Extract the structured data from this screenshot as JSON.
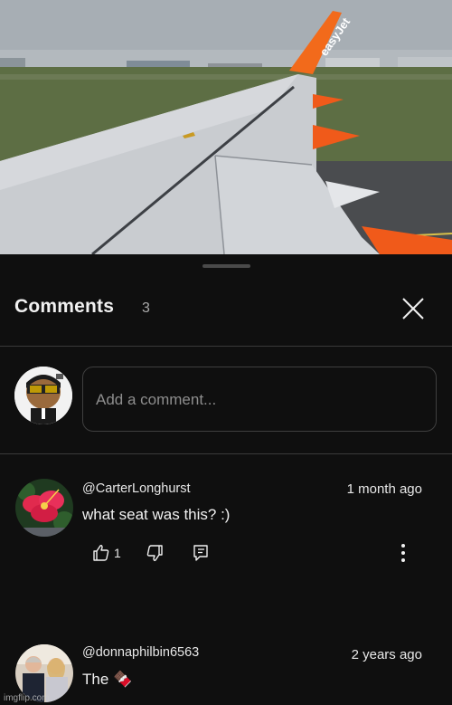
{
  "video": {
    "tail_logo": "easyJet",
    "accent_color": "#ff6600"
  },
  "comments": {
    "title": "Comments",
    "count": "3",
    "close_icon": "close-icon",
    "add_comment_placeholder": "Add a comment...",
    "items": [
      {
        "author": "@CarterLonghurst",
        "time": "1 month ago",
        "text": "what seat was this? :)",
        "likes": "1"
      },
      {
        "author": "@donnaphilbin6563",
        "time": "2 years ago",
        "text": "The 🍫"
      }
    ]
  },
  "watermark": "imgflip.com"
}
